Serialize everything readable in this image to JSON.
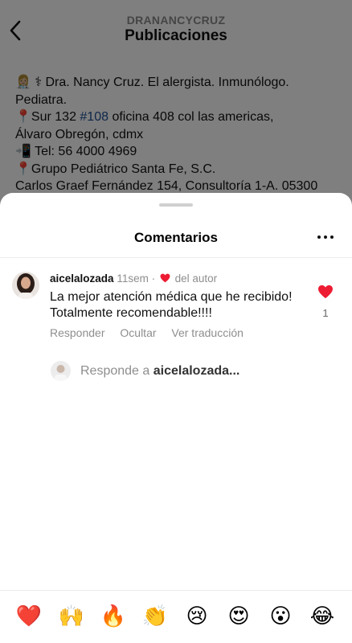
{
  "header": {
    "username": "DRANANCYCRUZ",
    "title": "Publicaciones"
  },
  "caption": {
    "line1": "Dra. Nancy Cruz. El alergista. Inmunólogo.",
    "line2": "Pediatra.",
    "line3_pre": "Sur 132 ",
    "line3_hashtag": "#108",
    "line3_post": " oficina 408 col las americas,",
    "line4": "Álvaro Obregón, cdmx",
    "line5": "Tel: 56 4000 4969",
    "line6": "Grupo Pediátrico Santa Fe, S.C.",
    "line7": "Carlos Graef Fernández 154, Consultoría 1-A. 05300"
  },
  "sheet": {
    "title": "Comentarios"
  },
  "comment": {
    "username": "aicelalozada",
    "time": "11sem",
    "separator": "·",
    "author_liked": "del autor",
    "text": "La mejor atención médica que he recibido! Totalmente recomendable!!!!",
    "actions": {
      "reply": "Responder",
      "hide": "Ocultar",
      "translate": "Ver traducción"
    },
    "like_count": "1"
  },
  "reply": {
    "prefix": "Responde a ",
    "target": "aicelalozada..."
  },
  "emojis": [
    "❤️",
    "🙌",
    "🔥",
    "👏",
    "😢",
    "😍",
    "😮",
    "😂"
  ],
  "colors": {
    "heart": "#ed1c33",
    "hashtag": "#1d4f91",
    "muted": "#8e8e8e"
  }
}
